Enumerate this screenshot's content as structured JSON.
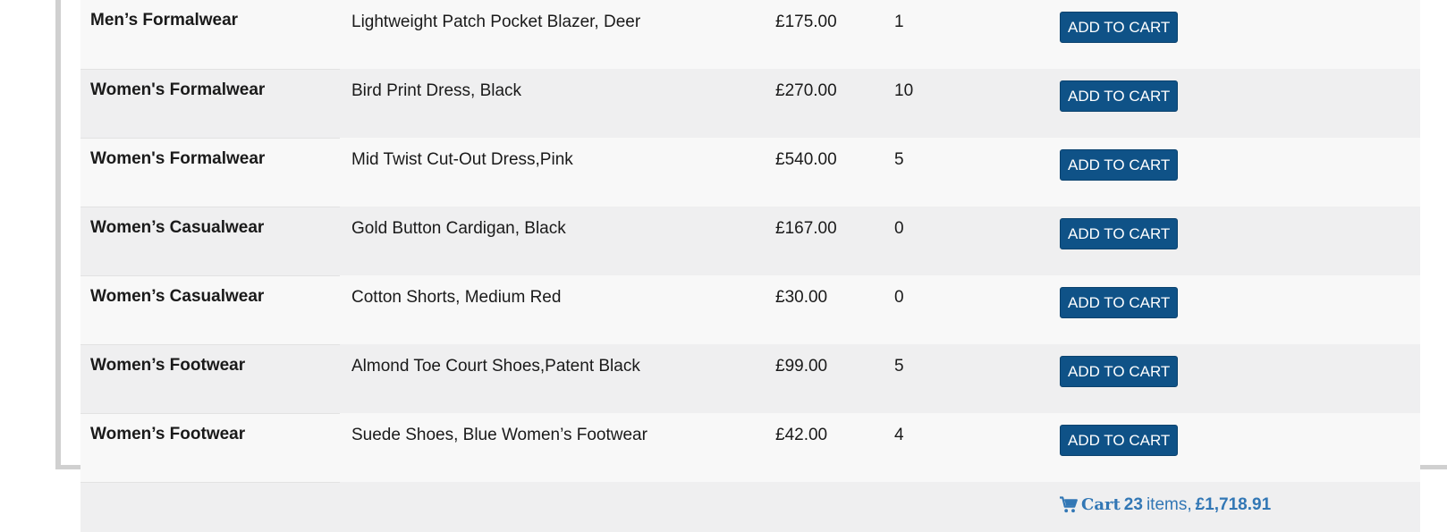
{
  "rows": [
    {
      "category": "Men’s Formalwear",
      "name": "Lightweight Patch Pocket Blazer, Deer",
      "price": "£175.00",
      "stock": "1",
      "button": "ADD TO CART"
    },
    {
      "category": "Women's Formalwear",
      "name": "Bird Print Dress, Black",
      "price": "£270.00",
      "stock": "10",
      "button": "ADD TO CART"
    },
    {
      "category": "Women's Formalwear",
      "name": "Mid Twist Cut-Out Dress,Pink",
      "price": "£540.00",
      "stock": "5",
      "button": "ADD TO CART"
    },
    {
      "category": "Women’s Casualwear",
      "name": "Gold Button Cardigan, Black",
      "price": "£167.00",
      "stock": "0",
      "button": "ADD TO CART"
    },
    {
      "category": "Women’s Casualwear",
      "name": "Cotton Shorts, Medium Red",
      "price": "£30.00",
      "stock": "0",
      "button": "ADD TO CART"
    },
    {
      "category": "Women’s Footwear",
      "name": "Almond Toe Court Shoes,Patent Black",
      "price": "£99.00",
      "stock": "5",
      "button": "ADD TO CART"
    },
    {
      "category": "Women’s Footwear",
      "name": "Suede Shoes, Blue Women’s Footwear",
      "price": "£42.00",
      "stock": "4",
      "button": "ADD TO CART"
    }
  ],
  "cart": {
    "icon": "shopping-cart-icon",
    "label": "Cart",
    "count": "23",
    "items_word": "items,",
    "total": "£1,718.91"
  },
  "colors": {
    "button_bg": "#0f5287",
    "link": "#3277b5",
    "row_light": "#f8f8f8",
    "row_dark": "#efeff0"
  }
}
